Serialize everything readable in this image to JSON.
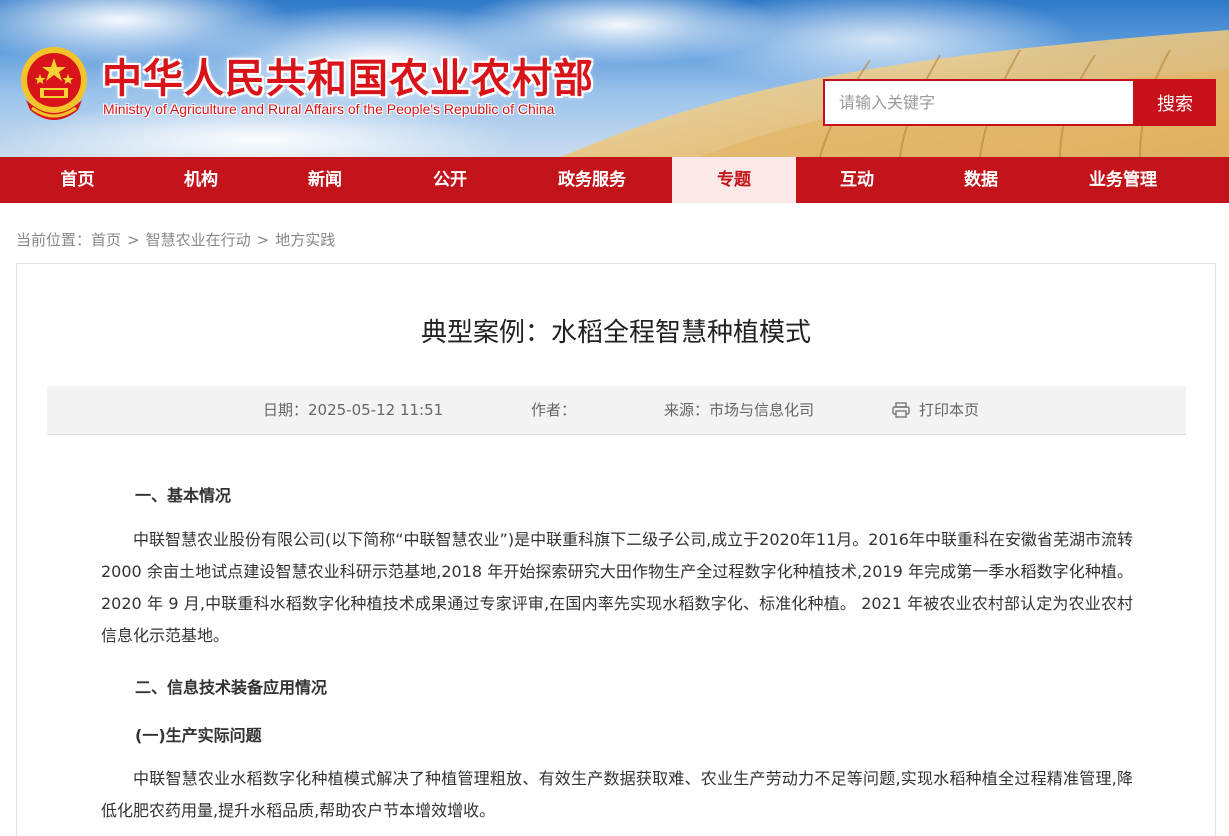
{
  "header": {
    "title_cn": "中华人民共和国农业农村部",
    "title_en": "Ministry of Agriculture and Rural Affairs of the People's Republic of China",
    "search_placeholder": "请输入关键字",
    "search_button": "搜索"
  },
  "nav": {
    "items": [
      {
        "label": "首页"
      },
      {
        "label": "机构"
      },
      {
        "label": "新闻"
      },
      {
        "label": "公开"
      },
      {
        "label": "政务服务"
      },
      {
        "label": "专题"
      },
      {
        "label": "互动"
      },
      {
        "label": "数据"
      },
      {
        "label": "业务管理"
      }
    ],
    "active_index": 5
  },
  "breadcrumb": {
    "prefix": "当前位置：",
    "items": [
      "首页",
      "智慧农业在行动",
      "地方实践"
    ],
    "separator": ">"
  },
  "article": {
    "title": "典型案例：水稻全程智慧种植模式",
    "meta": {
      "date": "日期：2025-05-12 11:51",
      "author": "作者：",
      "source": "来源：市场与信息化司",
      "print": "打印本页"
    },
    "sections": {
      "h1": "一、基本情况",
      "p1": "中联智慧农业股份有限公司(以下简称“中联智慧农业”)是中联重科旗下二级子公司,成立于2020年11月。2016年中联重科在安徽省芜湖市流转2000 余亩土地试点建设智慧农业科研示范基地,2018 年开始探索研究大田作物生产全过程数字化种植技术,2019 年完成第一季水稻数字化种植。 2020 年 9 月,中联重科水稻数字化种植技术成果通过专家评审,在国内率先实现水稻数字化、标准化种植。 2021 年被农业农村部认定为农业农村信息化示范基地。",
      "h2": "二、信息技术装备应用情况",
      "h3": "(一)生产实际问题",
      "p2": "中联智慧农业水稻数字化种植模式解决了种植管理粗放、有效生产数据获取难、农业生产劳动力不足等问题,实现水稻种植全过程精准管理,降低化肥农药用量,提升水稻品质,帮助农户节本增效增收。"
    }
  },
  "colors": {
    "brand_red": "#c3141c",
    "nav_active_bg": "#fbe8e8",
    "meta_bg": "#f3f3f3"
  }
}
